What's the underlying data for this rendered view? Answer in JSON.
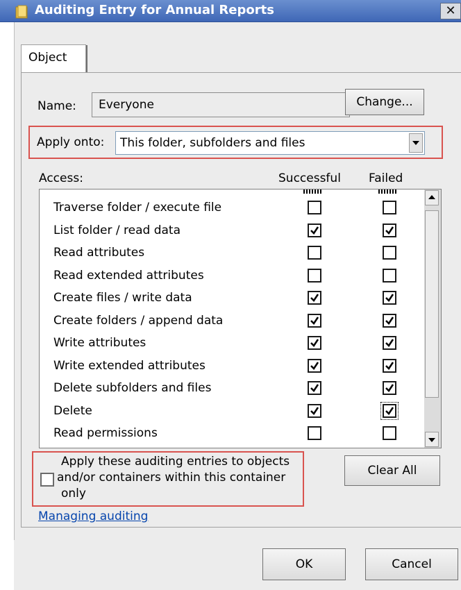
{
  "window": {
    "title": "Auditing Entry for Annual Reports",
    "close_glyph": "✕",
    "icon": "folder-icon"
  },
  "tabs": [
    {
      "label": "Object",
      "selected": true
    }
  ],
  "name_row": {
    "label": "Name:",
    "value": "Everyone",
    "change_button": "Change..."
  },
  "apply_onto": {
    "label": "Apply onto:",
    "selected": "This folder, subfolders and files"
  },
  "access": {
    "header_label": "Access:",
    "col_successful": "Successful",
    "col_failed": "Failed",
    "permissions": [
      {
        "label": "Traverse folder / execute file",
        "successful": false,
        "failed": false
      },
      {
        "label": "List folder / read data",
        "successful": true,
        "failed": true
      },
      {
        "label": "Read attributes",
        "successful": false,
        "failed": false
      },
      {
        "label": "Read extended attributes",
        "successful": false,
        "failed": false
      },
      {
        "label": "Create files / write data",
        "successful": true,
        "failed": true
      },
      {
        "label": "Create folders / append data",
        "successful": true,
        "failed": true
      },
      {
        "label": "Write attributes",
        "successful": true,
        "failed": true
      },
      {
        "label": "Write extended attributes",
        "successful": true,
        "failed": true
      },
      {
        "label": "Delete subfolders and files",
        "successful": true,
        "failed": true
      },
      {
        "label": "Delete",
        "successful": true,
        "failed": true,
        "focused_failed": true
      },
      {
        "label": "Read permissions",
        "successful": false,
        "failed": false
      }
    ]
  },
  "apply_container": {
    "checked": false,
    "text_lines": [
      "Apply these auditing entries to objects",
      "and/or containers within this container",
      "only"
    ]
  },
  "clear_all_button": "Clear All",
  "managing_link": "Managing auditing",
  "footer": {
    "ok": "OK",
    "cancel": "Cancel"
  },
  "colors": {
    "highlight": "#d9534f",
    "title_bar": "#3f67b6",
    "link": "#0645ad"
  }
}
